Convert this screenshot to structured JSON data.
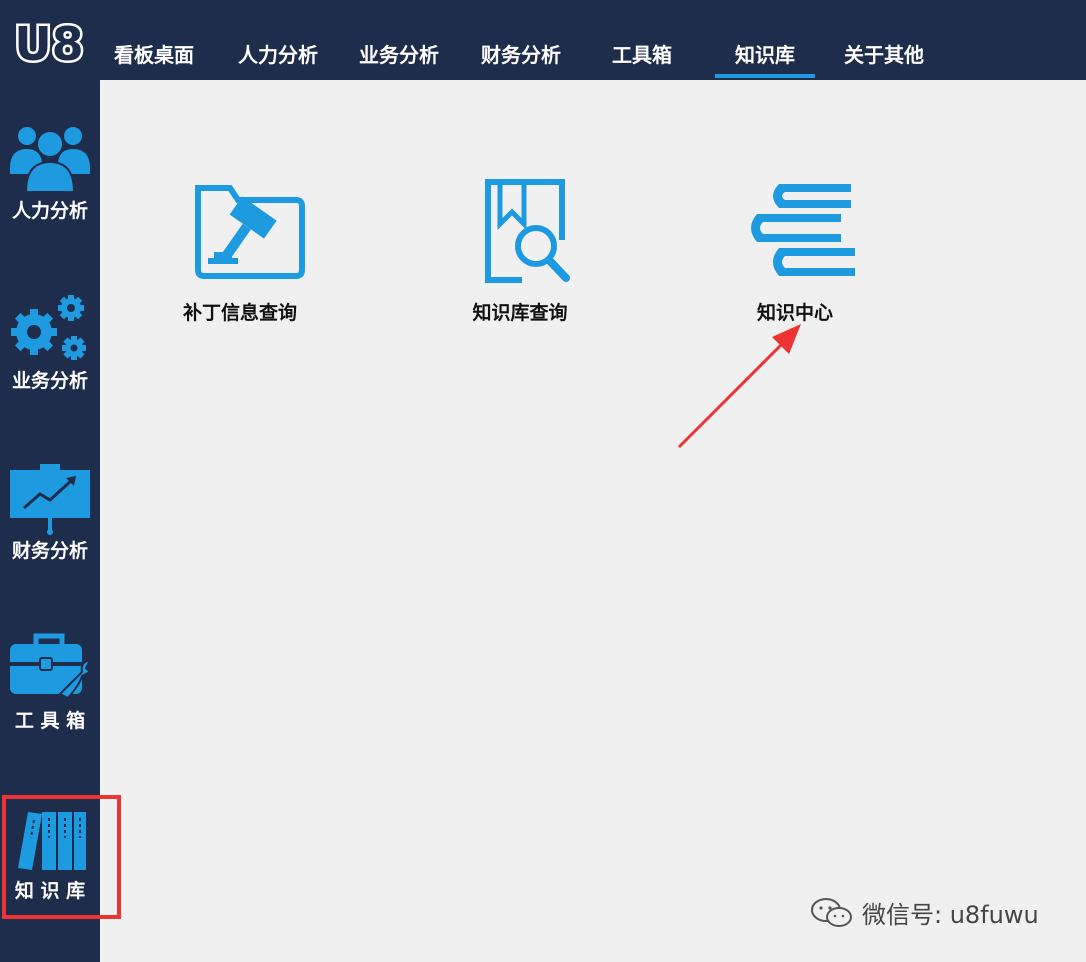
{
  "logo": {
    "text": "U8"
  },
  "tabs": [
    {
      "label": "看板桌面"
    },
    {
      "label": "人力分析"
    },
    {
      "label": "业务分析"
    },
    {
      "label": "财务分析"
    },
    {
      "label": "工具箱"
    },
    {
      "label": "知识库",
      "active": true
    },
    {
      "label": "关于其他"
    }
  ],
  "sidebar": {
    "items": [
      {
        "label": "人力分析",
        "icon": "people-icon"
      },
      {
        "label": "业务分析",
        "icon": "gears-icon"
      },
      {
        "label": "财务分析",
        "icon": "chart-board-icon"
      },
      {
        "label": "工 具 箱",
        "icon": "toolbox-icon"
      },
      {
        "label": "知 识 库",
        "icon": "books-icon",
        "active": true
      }
    ]
  },
  "tiles": [
    {
      "label": "补丁信息查询",
      "icon": "hammer-folder-icon"
    },
    {
      "label": "知识库查询",
      "icon": "book-search-icon"
    },
    {
      "label": "知识中心",
      "icon": "book-stack-icon"
    }
  ],
  "watermark": {
    "text": "微信号: u8fuwu"
  },
  "colors": {
    "header_bg": "#1e2d4b",
    "accent": "#1e9be0",
    "content_bg": "#f0f0f0",
    "highlight": "#ee3333"
  }
}
